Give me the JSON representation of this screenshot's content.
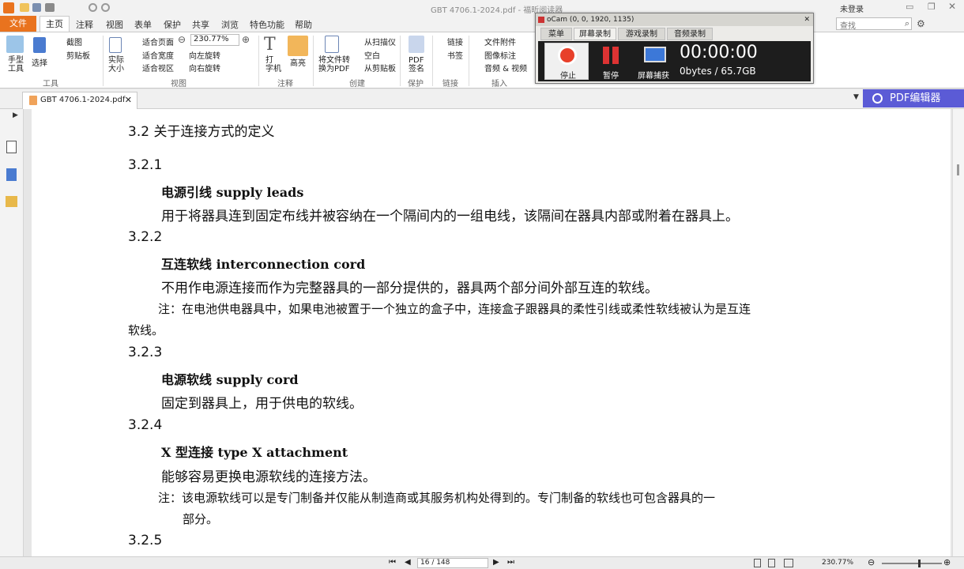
{
  "app": {
    "window_title": "GBT 4706.1-2024.pdf - 福昕阅读器",
    "login": "未登录",
    "search_placeholder": "查找"
  },
  "menu": [
    "文件",
    "主页",
    "注释",
    "视图",
    "表单",
    "保护",
    "共享",
    "浏览",
    "特色功能",
    "帮助"
  ],
  "ribbon": {
    "tools": {
      "hand": "手型\n工具",
      "select": "选择",
      "snapshot": "截图",
      "clipboard": "剪贴板",
      "group": "工具"
    },
    "view": {
      "actual": "实际\n大小",
      "fit_page": "适合页面",
      "fit_width": "适合宽度",
      "fit_area": "适合视区",
      "zoom": "230.77%",
      "rotate_left": "向左旋转",
      "rotate_right": "向右旋转",
      "group": "视图"
    },
    "annot": {
      "typewriter": "打\n字机",
      "highlight": "高亮",
      "group": "注释"
    },
    "create": {
      "to_pdf": "将文件转\n换为PDF",
      "scanner": "从扫描仪",
      "blank": "空白",
      "clipboard": "从剪贴板",
      "group": "创建"
    },
    "protect": {
      "sign": "PDF\n签名",
      "group": "保护"
    },
    "links": {
      "link": "链接",
      "bookmark": "书签",
      "group": "链接"
    },
    "insert": {
      "attach": "文件附件",
      "image": "图像标注",
      "av": "音频 & 视频",
      "group": "插入"
    }
  },
  "doc_tab": "GBT 4706.1-2024.pdf",
  "pdf_editor": "PDF编辑器",
  "document": {
    "section": "3.2   关于连接方式的定义",
    "items": [
      {
        "num": "3.2.1",
        "term": "电源引线    supply leads",
        "def": "用于将器具连到固定布线并被容纳在一个隔间内的一组电线，该隔间在器具内部或附着在器具上。"
      },
      {
        "num": "3.2.2",
        "term": "互连软线    interconnection cord",
        "def": "不用作电源连接而作为完整器具的一部分提供的，器具两个部分间外部互连的软线。",
        "note1": "注：在电池供电器具中，如果电池被置于一个独立的盒子中，连接盒子跟器具的柔性引线或柔性软线被认为是互连",
        "note2": "软线。"
      },
      {
        "num": "3.2.3",
        "term": "电源软线    supply cord",
        "def": "固定到器具上，用于供电的软线。"
      },
      {
        "num": "3.2.4",
        "term": "X 型连接    type X attachment",
        "def": "能够容易更换电源软线的连接方法。",
        "note1": "注：该电源软线可以是专门制备并仅能从制造商或其服务机构处得到的。专门制备的软线也可包含器具的一",
        "note2": "部分。"
      },
      {
        "num": "3.2.5"
      }
    ]
  },
  "status": {
    "page": "16 / 148",
    "zoom": "230.77%"
  },
  "ocam": {
    "title": "oCam (0, 0, 1920, 1135)",
    "tabs": [
      "菜单",
      "屏幕录制",
      "游戏录制",
      "音频录制"
    ],
    "stop": "停止",
    "pause": "暂停",
    "capture": "屏幕捕获",
    "time": "00:00:00",
    "size": "0bytes / 65.7GB"
  },
  "colors": {
    "accent": "#e9731e",
    "editor": "#5b5bd6",
    "ocam_stop": "#e8402a"
  }
}
